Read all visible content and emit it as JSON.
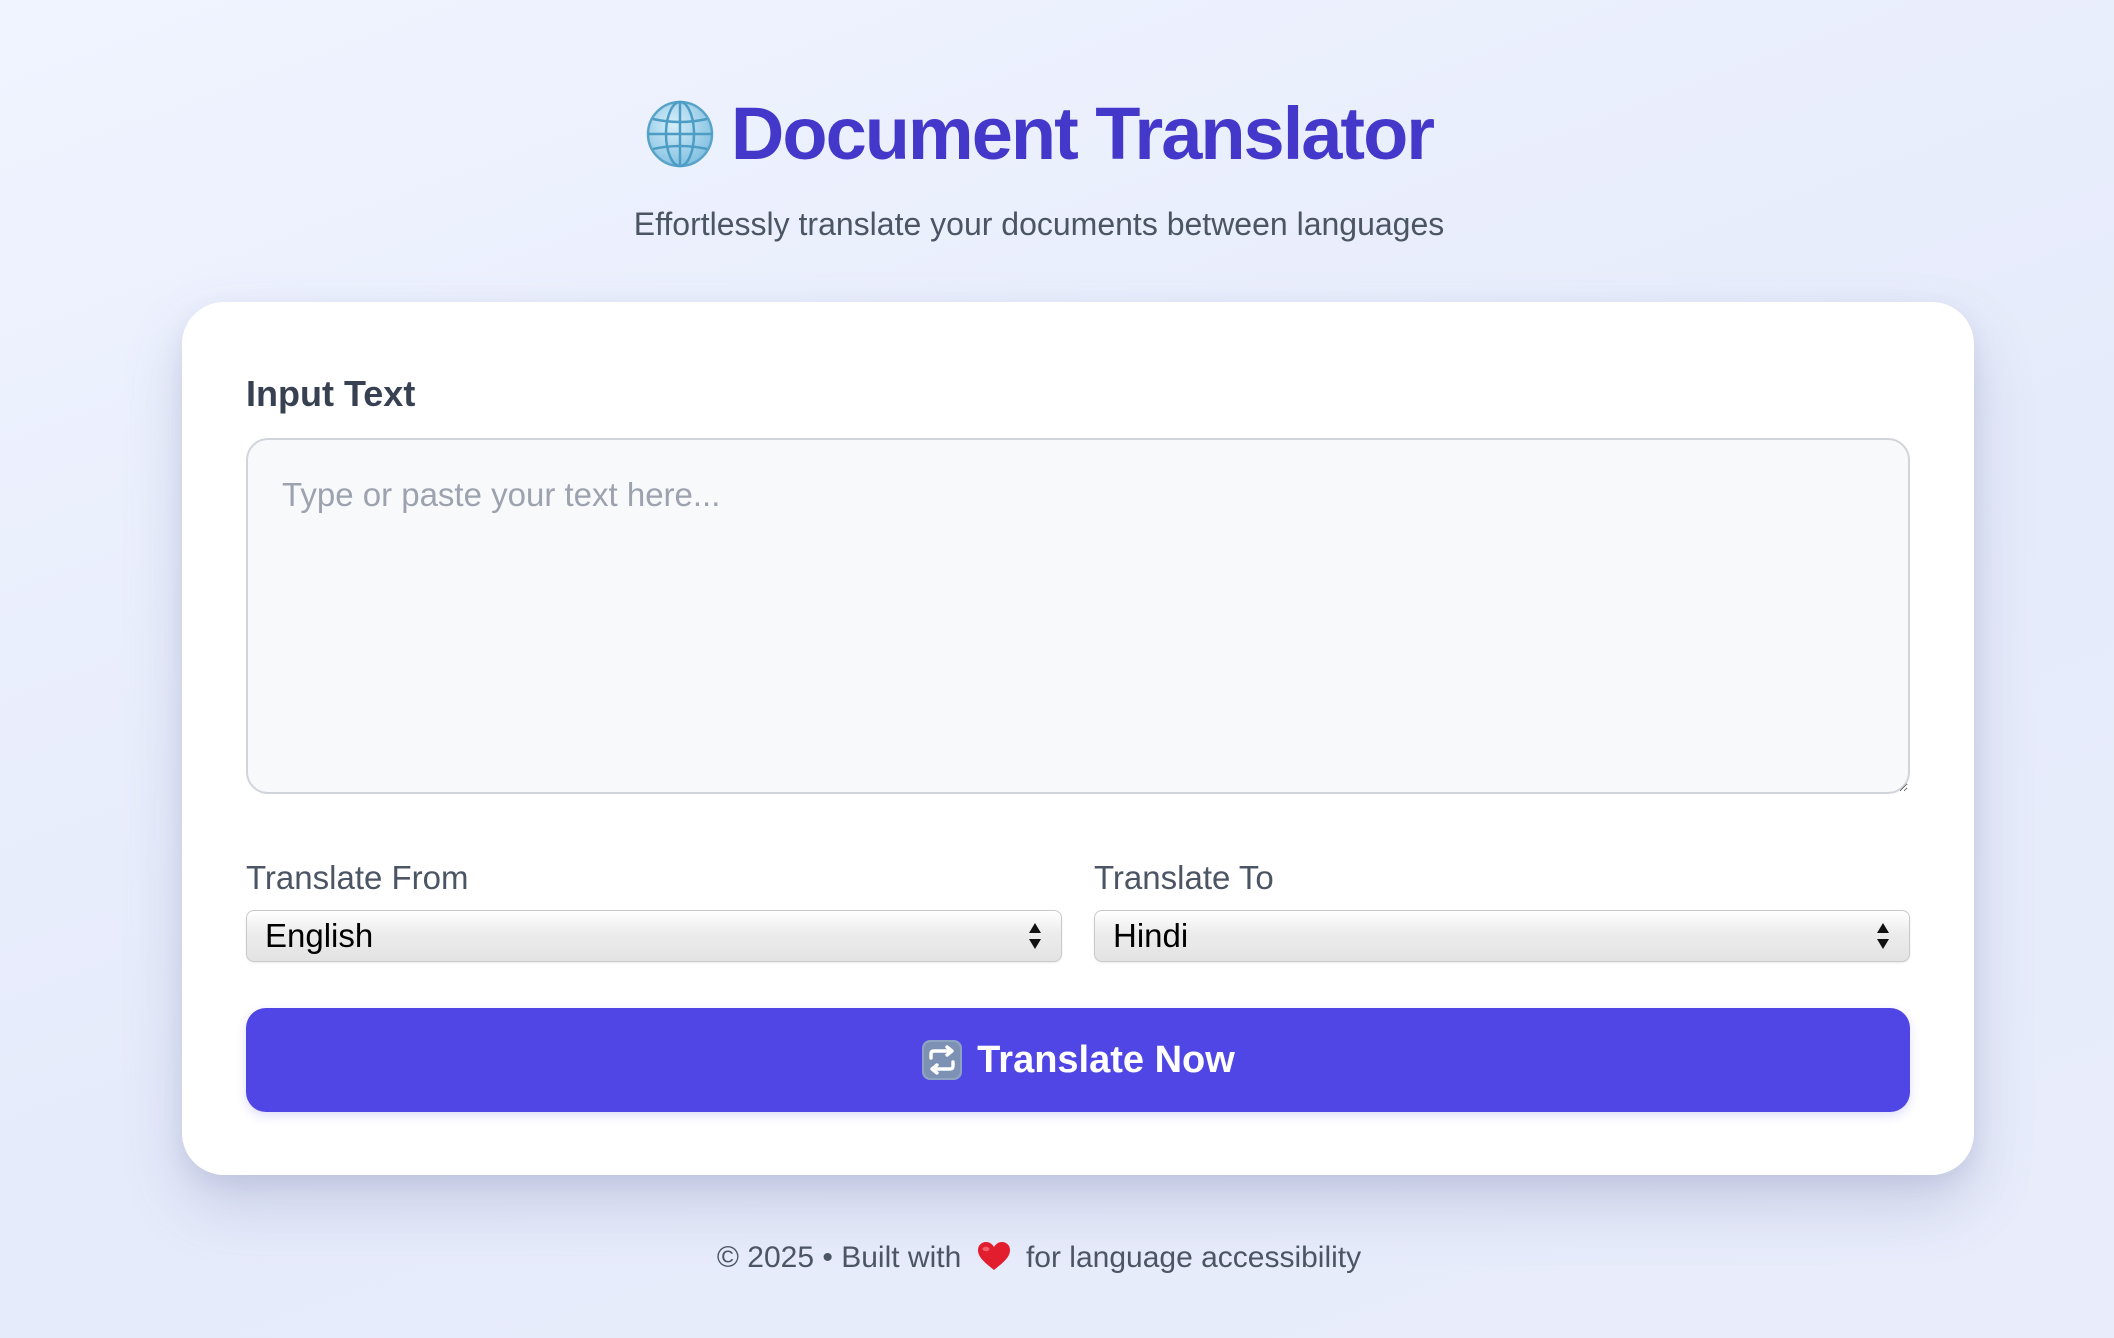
{
  "header": {
    "title": "Document Translator",
    "title_icon": "globe-icon",
    "subtitle": "Effortlessly translate your documents between languages"
  },
  "form": {
    "input_label": "Input Text",
    "input_value": "",
    "input_placeholder": "Type or paste your text here...",
    "from_label": "Translate From",
    "from_value": "English",
    "to_label": "Translate To",
    "to_value": "Hindi",
    "button_label": "Translate Now",
    "button_icon": "repeat-icon"
  },
  "footer": {
    "prefix": "© 2025 • Built with",
    "heart_icon": "heart-icon",
    "suffix": "for language accessibility"
  },
  "colors": {
    "accent": "#4f46e5",
    "title": "#4338ca",
    "heart": "#e11d2e"
  }
}
